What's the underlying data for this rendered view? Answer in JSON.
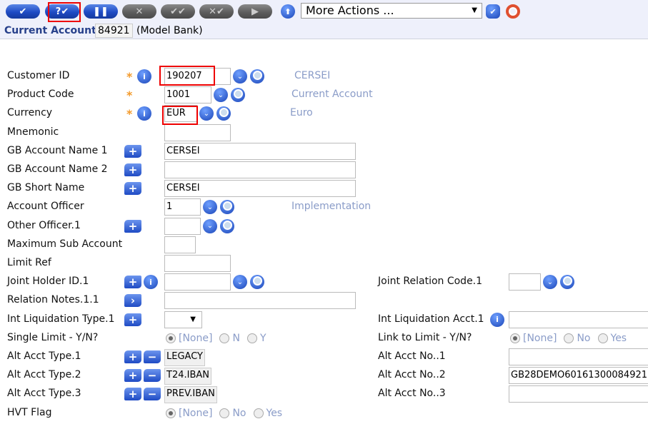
{
  "toolbar": {
    "buttons": [
      {
        "name": "commit-button",
        "glyph": "✔",
        "style": "blue"
      },
      {
        "name": "validate-button",
        "glyph": "?✔",
        "style": "blue"
      },
      {
        "name": "hold-button",
        "glyph": "❚❚",
        "style": "blue"
      },
      {
        "name": "delete-button",
        "glyph": "✕",
        "style": "grey"
      },
      {
        "name": "authorise-button",
        "glyph": "✔✔",
        "style": "grey"
      },
      {
        "name": "reverse-button",
        "glyph": "✕✔",
        "style": "grey"
      },
      {
        "name": "next-button",
        "glyph": "▶",
        "style": "grey"
      }
    ],
    "more_actions": "More Actions ...",
    "up_glyph": "⬆",
    "go_glyph": "✔"
  },
  "header": {
    "title": "Current Account",
    "id": "84921",
    "company": "(Model Bank)"
  },
  "left": [
    {
      "label": "Customer ID",
      "req": true,
      "info": true,
      "type": "text",
      "value": "190207",
      "dd": true,
      "lk": true,
      "enrich": "CERSEI"
    },
    {
      "label": "Product Code",
      "req": true,
      "type": "text",
      "value": "1001",
      "dd": true,
      "lk": true,
      "enrich": "Current Account"
    },
    {
      "label": "Currency",
      "req": true,
      "info": true,
      "type": "text",
      "value": "EUR",
      "dd": true,
      "lk": true,
      "enrich": "Euro"
    },
    {
      "label": "Mnemonic",
      "type": "text",
      "value": ""
    },
    {
      "label": "GB Account Name 1",
      "plus": true,
      "type": "text",
      "value": "CERSEI"
    },
    {
      "label": "GB Account Name 2",
      "plus": true,
      "type": "text",
      "value": ""
    },
    {
      "label": "GB Short Name",
      "plus": true,
      "type": "text",
      "value": "CERSEI"
    },
    {
      "label": "Account Officer",
      "type": "text",
      "value": "1",
      "dd": true,
      "lk": true,
      "enrich": "Implementation"
    },
    {
      "label": "Other Officer.1",
      "plus": true,
      "type": "text",
      "value": "",
      "dd": true,
      "lk": true
    },
    {
      "label": "Maximum Sub Account",
      "type": "text",
      "value": ""
    },
    {
      "label": "Limit Ref",
      "type": "text",
      "value": ""
    },
    {
      "label": "Joint Holder ID.1",
      "plus": true,
      "info": true,
      "type": "text",
      "value": "",
      "dd": true,
      "lk": true
    },
    {
      "label": "Relation Notes.1.1",
      "expand": true,
      "type": "text",
      "value": ""
    },
    {
      "label": "Int Liquidation Type.1",
      "plus": true,
      "type": "select",
      "value": ""
    },
    {
      "label": "Single Limit - Y/N?",
      "type": "radio",
      "options": [
        "[None]",
        "N",
        "Y"
      ]
    },
    {
      "label": "Alt Acct Type.1",
      "plus": true,
      "minus": true,
      "type": "static",
      "value": "LEGACY"
    },
    {
      "label": "Alt Acct Type.2",
      "plus": true,
      "minus": true,
      "type": "static",
      "value": "T24.IBAN"
    },
    {
      "label": "Alt Acct Type.3",
      "plus": true,
      "minus": true,
      "type": "static",
      "value": "PREV.IBAN"
    },
    {
      "label": "HVT Flag",
      "type": "radio",
      "options": [
        "[None]",
        "No",
        "Yes"
      ]
    }
  ],
  "right": [
    {
      "row": 11,
      "label": "Joint Relation Code.1",
      "type": "text",
      "value": "",
      "dd": true,
      "lk": true
    },
    {
      "row": 13,
      "label": "Int Liquidation Acct.1",
      "info": true,
      "type": "text",
      "value": ""
    },
    {
      "row": 14,
      "label": "Link to Limit - Y/N?",
      "type": "radio",
      "options": [
        "[None]",
        "No",
        "Yes"
      ]
    },
    {
      "row": 15,
      "label": "Alt Acct No..1",
      "type": "text",
      "value": ""
    },
    {
      "row": 16,
      "label": "Alt Acct No..2",
      "type": "text",
      "value": "GB28DEMO60161300084921"
    },
    {
      "row": 17,
      "label": "Alt Acct No..3",
      "type": "text",
      "value": ""
    }
  ],
  "icons": {
    "info": "i",
    "plus": "+",
    "minus": "−",
    "expand": "›",
    "dd": "⌄",
    "star": "*",
    "select_arrow": "▼"
  }
}
